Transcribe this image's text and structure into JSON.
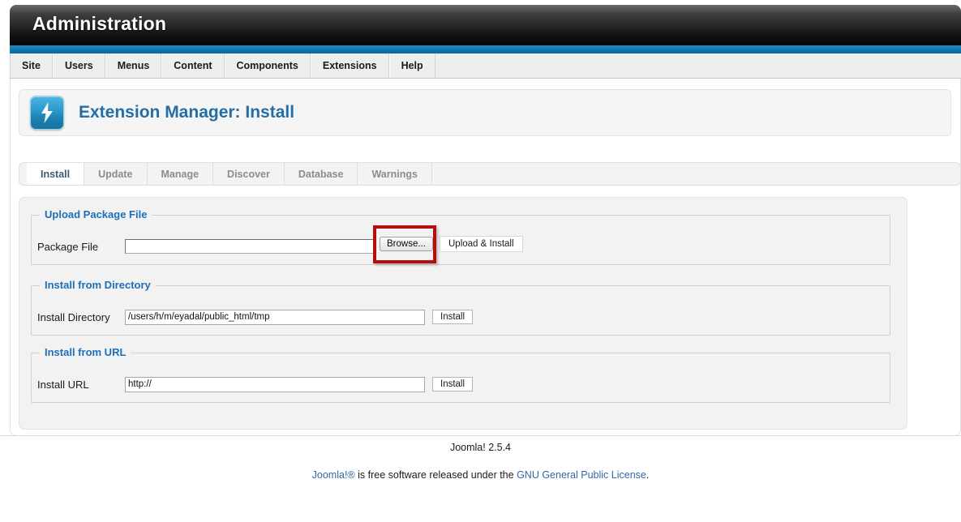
{
  "header": {
    "title": "Administration"
  },
  "menu": {
    "items": [
      {
        "label": "Site"
      },
      {
        "label": "Users"
      },
      {
        "label": "Menus"
      },
      {
        "label": "Content"
      },
      {
        "label": "Components"
      },
      {
        "label": "Extensions"
      },
      {
        "label": "Help"
      }
    ]
  },
  "page": {
    "icon": "lightning-bolt-icon",
    "title": "Extension Manager: Install"
  },
  "tabs": [
    {
      "label": "Install",
      "active": true
    },
    {
      "label": "Update",
      "active": false
    },
    {
      "label": "Manage",
      "active": false
    },
    {
      "label": "Discover",
      "active": false
    },
    {
      "label": "Database",
      "active": false
    },
    {
      "label": "Warnings",
      "active": false
    }
  ],
  "upload_package": {
    "legend": "Upload Package File",
    "label": "Package File",
    "file_value": "",
    "browse_label": "Browse...",
    "upload_label": "Upload & Install"
  },
  "install_directory": {
    "legend": "Install from Directory",
    "label": "Install Directory",
    "value": "/users/h/m/eyadal/public_html/tmp",
    "button_label": "Install"
  },
  "install_url": {
    "legend": "Install from URL",
    "label": "Install URL",
    "value": "http://",
    "button_label": "Install"
  },
  "footer": {
    "version": "Joomla! 2.5.4",
    "license_prefix": "Joomla!®",
    "license_middle": " is free software released under the ",
    "license_link": "GNU General Public License",
    "license_suffix": "."
  },
  "colors": {
    "accent_blue": "#1d6fb8",
    "title_blue": "#246ea5",
    "bar_blue": "#1273a9",
    "highlight_red": "#b40f0f",
    "link_blue": "#3067a8"
  }
}
